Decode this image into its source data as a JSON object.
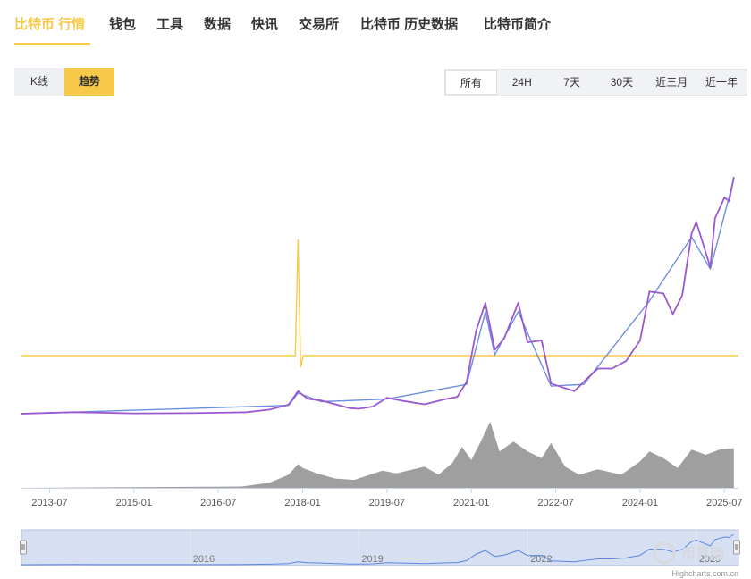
{
  "nav": {
    "items": [
      {
        "label": "比特币 行情",
        "name": "nav-tab-market",
        "active": true
      },
      {
        "label": "钱包",
        "name": "nav-tab-wallet",
        "active": false
      },
      {
        "label": "工具",
        "name": "nav-tab-tools",
        "active": false
      },
      {
        "label": "数据",
        "name": "nav-tab-data",
        "active": false
      },
      {
        "label": "快讯",
        "name": "nav-tab-news",
        "active": false
      },
      {
        "label": "交易所",
        "name": "nav-tab-exchange",
        "active": false
      },
      {
        "label": "比特币 历史数据",
        "name": "nav-tab-history",
        "active": false
      },
      {
        "label": "比特币简介",
        "name": "nav-tab-intro",
        "active": false
      }
    ]
  },
  "mode_buttons": [
    {
      "label": "K线",
      "active": false
    },
    {
      "label": "趋势",
      "active": true
    }
  ],
  "range_buttons": [
    {
      "label": "所有",
      "active": true
    },
    {
      "label": "24H",
      "active": false
    },
    {
      "label": "7天",
      "active": false
    },
    {
      "label": "30天",
      "active": false
    },
    {
      "label": "近三月",
      "active": false
    },
    {
      "label": "近一年",
      "active": false
    }
  ],
  "credit": "Highcharts.com.cn",
  "watermark": "币界网",
  "colors": {
    "accent": "#f7c948",
    "price_purple": "#9b59d0",
    "price_blue": "#6b8fe0",
    "secondary_line": "#f7c948",
    "volume": "#8e8e8e",
    "navigator_fill": "#c9d5ee",
    "navigator_line": "#5b85e0"
  },
  "chart_data": {
    "type": "line",
    "x_range": [
      "2013-01",
      "2025-10"
    ],
    "xtick_labels": [
      "2013-07",
      "2015-01",
      "2016-07",
      "2018-01",
      "2019-07",
      "2021-01",
      "2022-07",
      "2024-01",
      "2025-07"
    ],
    "navigator_ticks": [
      "2016",
      "2019",
      "2022",
      "2025"
    ],
    "series": [
      {
        "role": "price_primary",
        "color": "#9b59d0",
        "points": [
          [
            "2013-01",
            0.0
          ],
          [
            "2013-12",
            0.8
          ],
          [
            "2014-06",
            0.5
          ],
          [
            "2015-01",
            0.2
          ],
          [
            "2016-01",
            0.3
          ],
          [
            "2016-07",
            0.5
          ],
          [
            "2017-01",
            0.8
          ],
          [
            "2017-06",
            2.2
          ],
          [
            "2017-10",
            4.8
          ],
          [
            "2017-12",
            12.0
          ],
          [
            "2018-02",
            8.0
          ],
          [
            "2018-05",
            7.0
          ],
          [
            "2018-08",
            5.0
          ],
          [
            "2018-11",
            3.0
          ],
          [
            "2019-01",
            2.6
          ],
          [
            "2019-04",
            3.8
          ],
          [
            "2019-07",
            8.5
          ],
          [
            "2019-10",
            7.0
          ],
          [
            "2020-03",
            5.0
          ],
          [
            "2020-07",
            7.5
          ],
          [
            "2020-10",
            9.0
          ],
          [
            "2020-12",
            17.0
          ],
          [
            "2021-02",
            44.0
          ],
          [
            "2021-04",
            59.0
          ],
          [
            "2021-06",
            34.0
          ],
          [
            "2021-08",
            40.0
          ],
          [
            "2021-11",
            59.0
          ],
          [
            "2022-01",
            38.0
          ],
          [
            "2022-04",
            39.0
          ],
          [
            "2022-06",
            16.0
          ],
          [
            "2022-11",
            12.0
          ],
          [
            "2023-01",
            17.0
          ],
          [
            "2023-04",
            24.0
          ],
          [
            "2023-07",
            24.0
          ],
          [
            "2023-10",
            28.0
          ],
          [
            "2024-01",
            39.0
          ],
          [
            "2024-03",
            65.0
          ],
          [
            "2024-06",
            64.0
          ],
          [
            "2024-08",
            53.0
          ],
          [
            "2024-10",
            63.0
          ],
          [
            "2024-12",
            96.0
          ],
          [
            "2025-01",
            102.0
          ],
          [
            "2025-04",
            78.0
          ],
          [
            "2025-05",
            104.0
          ],
          [
            "2025-07",
            115.0
          ],
          [
            "2025-08",
            113.0
          ],
          [
            "2025-09",
            126.0
          ]
        ]
      },
      {
        "role": "price_secondary",
        "color": "#6b8fe0",
        "points": [
          [
            "2013-01",
            0.0
          ],
          [
            "2017-10",
            4.4
          ],
          [
            "2017-12",
            11.0
          ],
          [
            "2018-05",
            6.4
          ],
          [
            "2019-07",
            7.8
          ],
          [
            "2020-12",
            15.6
          ],
          [
            "2021-04",
            54.3
          ],
          [
            "2021-06",
            31.3
          ],
          [
            "2021-11",
            54.3
          ],
          [
            "2022-06",
            14.7
          ],
          [
            "2023-01",
            15.6
          ],
          [
            "2024-03",
            60.0
          ],
          [
            "2024-12",
            94.0
          ],
          [
            "2025-04",
            77.0
          ],
          [
            "2025-09",
            125.0
          ]
        ]
      },
      {
        "role": "indicator",
        "color": "#f7c948",
        "baseline": 0.0,
        "spike_date": "2017-12",
        "spike_up": 1.0,
        "spike_down": -0.1
      }
    ],
    "volume": {
      "color": "#8e8e8e",
      "points": [
        [
          "2013-01",
          0.0
        ],
        [
          "2016-12",
          0.02
        ],
        [
          "2017-06",
          0.08
        ],
        [
          "2017-10",
          0.2
        ],
        [
          "2017-12",
          0.36
        ],
        [
          "2018-01",
          0.3
        ],
        [
          "2018-04",
          0.22
        ],
        [
          "2018-08",
          0.14
        ],
        [
          "2018-12",
          0.12
        ],
        [
          "2019-06",
          0.26
        ],
        [
          "2019-09",
          0.22
        ],
        [
          "2020-03",
          0.32
        ],
        [
          "2020-06",
          0.2
        ],
        [
          "2020-09",
          0.38
        ],
        [
          "2020-11",
          0.62
        ],
        [
          "2021-01",
          0.42
        ],
        [
          "2021-03",
          0.7
        ],
        [
          "2021-05",
          1.0
        ],
        [
          "2021-07",
          0.55
        ],
        [
          "2021-10",
          0.7
        ],
        [
          "2022-01",
          0.55
        ],
        [
          "2022-04",
          0.45
        ],
        [
          "2022-06",
          0.68
        ],
        [
          "2022-09",
          0.32
        ],
        [
          "2022-12",
          0.2
        ],
        [
          "2023-04",
          0.28
        ],
        [
          "2023-09",
          0.2
        ],
        [
          "2024-01",
          0.4
        ],
        [
          "2024-03",
          0.55
        ],
        [
          "2024-06",
          0.45
        ],
        [
          "2024-09",
          0.3
        ],
        [
          "2024-12",
          0.58
        ],
        [
          "2025-03",
          0.5
        ],
        [
          "2025-06",
          0.58
        ],
        [
          "2025-09",
          0.6
        ]
      ]
    }
  }
}
